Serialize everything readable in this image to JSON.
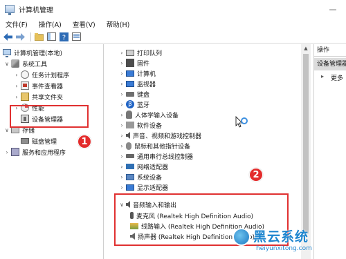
{
  "window": {
    "title": "计算机管理"
  },
  "menu": [
    "文件(F)",
    "操作(A)",
    "查看(V)",
    "帮助(H)"
  ],
  "left_tree": {
    "root": "计算机管理(本地)",
    "system_tools": "系统工具",
    "task_scheduler": "任务计划程序",
    "event_viewer": "事件查看器",
    "shared_folders": "共享文件夹",
    "performance": "性能",
    "device_manager": "设备管理器",
    "storage": "存储",
    "disk_management": "磁盘管理",
    "services_apps": "服务和应用程序"
  },
  "device_tree": [
    "打印队列",
    "固件",
    "计算机",
    "监视器",
    "键盘",
    "蓝牙",
    "人体学输入设备",
    "软件设备",
    "声音、视频和游戏控制器",
    "鼠标和其他指针设备",
    "通用串行总线控制器",
    "网络适配器",
    "系统设备",
    "显示适配器"
  ],
  "audio": {
    "category": "音频输入和输出",
    "items": [
      "麦克风 (Realtek High Definition Audio)",
      "线路输入 (Realtek High Definition Audio)",
      "扬声器 (Realtek High Definition Audio)"
    ]
  },
  "actions": {
    "header": "操作",
    "section": "设备管理器",
    "more": "更多"
  },
  "annotations": {
    "badge1": "1",
    "badge2": "2"
  },
  "watermark": {
    "text": "黑云系统",
    "url": "heiyunxitong.com"
  },
  "colors": {
    "annotation_red": "#e03030",
    "selection": "#cce4f7",
    "watermark_blue": "#1f86cf"
  }
}
